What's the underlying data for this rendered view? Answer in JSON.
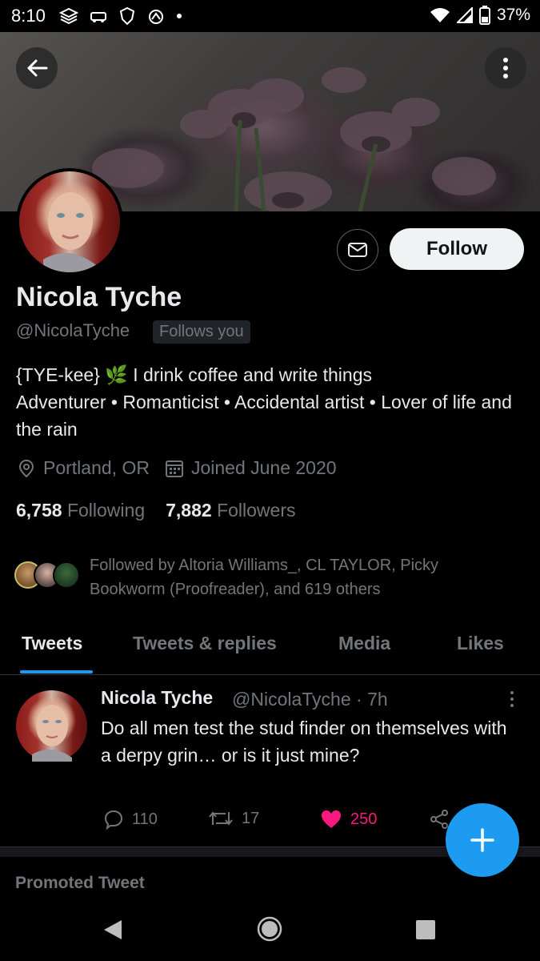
{
  "status_bar": {
    "time": "8:10",
    "battery": "37%"
  },
  "profile": {
    "name": "Nicola Tyche",
    "handle": "@NicolaTyche",
    "follows_you": "Follows you",
    "follow_label": "Follow",
    "bio_line1": "{TYE-kee} 🌿 I drink coffee and write things",
    "bio_line2": "Adventurer • Romanticist • Accidental artist • Lover of life and the rain",
    "location": "Portland, OR",
    "joined": "Joined June 2020",
    "following_count": "6,758",
    "following_label": "Following",
    "followers_count": "7,882",
    "followers_label": "Followers",
    "followed_by": "Followed by Altoria Williams_, CL TAYLOR, Picky Bookworm (Proofreader), and 619 others"
  },
  "tabs": [
    {
      "label": "Tweets"
    },
    {
      "label": "Tweets & replies"
    },
    {
      "label": "Media"
    },
    {
      "label": "Likes"
    }
  ],
  "tweet": {
    "name": "Nicola Tyche",
    "handle_time": "@NicolaTyche · 7h",
    "body": "Do all men test the stud finder on themselves with a derpy grin… or is it just mine?",
    "replies": "110",
    "retweets": "17",
    "likes": "250"
  },
  "promoted_label": "Promoted Tweet",
  "colors": {
    "accent": "#1d9bf0",
    "like": "#f91880",
    "muted": "#71767b"
  },
  "icons": [
    "back-arrow-icon",
    "more-vertical-icon",
    "mail-icon",
    "location-pin-icon",
    "calendar-icon",
    "reply-icon",
    "retweet-icon",
    "heart-icon",
    "share-icon",
    "plus-icon"
  ]
}
